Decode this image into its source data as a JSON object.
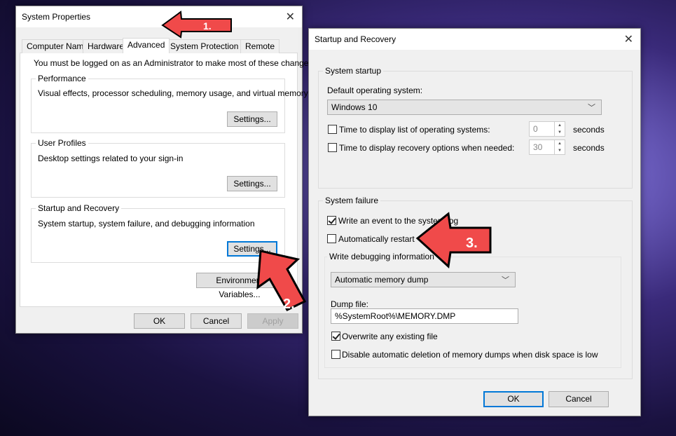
{
  "system_properties": {
    "title": "System Properties",
    "tabs": [
      "Computer Name",
      "Hardware",
      "Advanced",
      "System Protection",
      "Remote"
    ],
    "active_tab": "Advanced",
    "admin_note": "You must be logged on as an Administrator to make most of these changes.",
    "performance": {
      "label": "Performance",
      "desc": "Visual effects, processor scheduling, memory usage, and virtual memory",
      "button": "Settings..."
    },
    "user_profiles": {
      "label": "User Profiles",
      "desc": "Desktop settings related to your sign-in",
      "button": "Settings..."
    },
    "startup_recovery": {
      "label": "Startup and Recovery",
      "desc": "System startup, system failure, and debugging information",
      "button": "Settings..."
    },
    "env_button": "Environment Variables...",
    "ok": "OK",
    "cancel": "Cancel",
    "apply": "Apply"
  },
  "startup_recovery": {
    "title": "Startup and Recovery",
    "system_startup": {
      "label": "System startup",
      "default_os_label": "Default operating system:",
      "default_os": "Windows 10",
      "time_list_label": "Time to display list of operating systems:",
      "time_list_checked": false,
      "time_list_value": "0",
      "time_recovery_label": "Time to display recovery options when needed:",
      "time_recovery_checked": false,
      "time_recovery_value": "30",
      "seconds": "seconds"
    },
    "system_failure": {
      "label": "System failure",
      "write_event": "Write an event to the system log",
      "write_event_checked": true,
      "auto_restart": "Automatically restart",
      "auto_restart_checked": false,
      "debug_label": "Write debugging information",
      "debug_type": "Automatic memory dump",
      "dump_file_label": "Dump file:",
      "dump_file": "%SystemRoot%\\MEMORY.DMP",
      "overwrite": "Overwrite any existing file",
      "overwrite_checked": true,
      "disable_auto_delete": "Disable automatic deletion of memory dumps when disk space is low",
      "disable_auto_delete_checked": false
    },
    "ok": "OK",
    "cancel": "Cancel"
  },
  "annotations": {
    "step1": "1.",
    "step2": "2.",
    "step3": "3.",
    "arrow_color": "#f04a4a"
  }
}
